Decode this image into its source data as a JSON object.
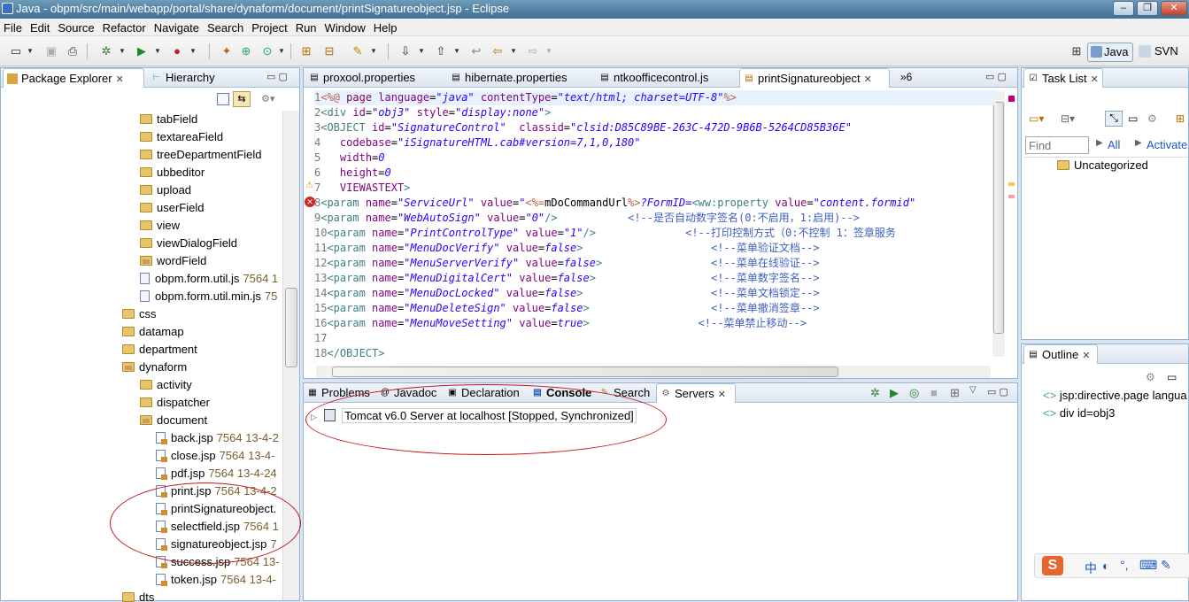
{
  "window": {
    "title": "Java - obpm/src/main/webapp/portal/share/dynaform/document/printSignatureobject.jsp - Eclipse"
  },
  "menu": [
    "File",
    "Edit",
    "Source",
    "Refactor",
    "Navigate",
    "Search",
    "Project",
    "Run",
    "Window",
    "Help"
  ],
  "perspectives": {
    "java": "Java",
    "svn": "SVN"
  },
  "left_tabs": {
    "package_explorer": "Package Explorer",
    "hierarchy": "Hierarchy"
  },
  "tree": [
    {
      "label": "tabField",
      "kind": "folder",
      "indent": 2
    },
    {
      "label": "textareaField",
      "kind": "folder",
      "indent": 2
    },
    {
      "label": "treeDepartmentField",
      "kind": "folder",
      "indent": 2
    },
    {
      "label": "ubbeditor",
      "kind": "folder",
      "indent": 2
    },
    {
      "label": "upload",
      "kind": "folder",
      "indent": 2
    },
    {
      "label": "userField",
      "kind": "folder",
      "indent": 2
    },
    {
      "label": "view",
      "kind": "folder",
      "indent": 2
    },
    {
      "label": "viewDialogField",
      "kind": "folder",
      "indent": 2
    },
    {
      "label": "wordField",
      "kind": "pkgfolder",
      "indent": 2
    },
    {
      "label": "obpm.form.util.js",
      "meta": "7564 1",
      "kind": "js",
      "indent": 2
    },
    {
      "label": "obpm.form.util.min.js",
      "meta": "75",
      "kind": "js",
      "indent": 2
    },
    {
      "label": "css",
      "kind": "folder",
      "indent": 1
    },
    {
      "label": "datamap",
      "kind": "folder",
      "indent": 1
    },
    {
      "label": "department",
      "kind": "folder",
      "indent": 1
    },
    {
      "label": "dynaform",
      "kind": "pkgfolder",
      "indent": 1
    },
    {
      "label": "activity",
      "kind": "folder",
      "indent": 2
    },
    {
      "label": "dispatcher",
      "kind": "folder",
      "indent": 2
    },
    {
      "label": "document",
      "kind": "pkgfolder",
      "indent": 2
    },
    {
      "label": "back.jsp",
      "meta": "7564  13-4-2",
      "kind": "jsp",
      "indent": 3
    },
    {
      "label": "close.jsp",
      "meta": "7564  13-4-",
      "kind": "jsp",
      "indent": 3
    },
    {
      "label": "pdf.jsp",
      "meta": "7564  13-4-24",
      "kind": "jsp",
      "indent": 3
    },
    {
      "label": "print.jsp",
      "meta": "7564  13-4-2",
      "kind": "jsp",
      "indent": 3
    },
    {
      "label": "printSignatureobject.",
      "meta": "",
      "kind": "jsp",
      "indent": 3
    },
    {
      "label": "selectfield.jsp",
      "meta": "7564  1",
      "kind": "jsp",
      "indent": 3
    },
    {
      "label": "signatureobject.jsp",
      "meta": "7",
      "kind": "jsp",
      "indent": 3
    },
    {
      "label": "success.jsp",
      "meta": "7564  13-",
      "kind": "jsp",
      "indent": 3
    },
    {
      "label": "token.jsp",
      "meta": "7564  13-4-",
      "kind": "jsp",
      "indent": 3
    },
    {
      "label": "dts",
      "kind": "folder",
      "indent": 1
    }
  ],
  "editor_tabs": [
    "proxool.properties",
    "hibernate.properties",
    "ntkoofficecontrol.js",
    "printSignatureobject"
  ],
  "editor_overflow": "»6",
  "code_lines": [
    [
      [
        "dir",
        "<%@ "
      ],
      [
        "kw",
        "page "
      ],
      [
        "at",
        "language"
      ],
      [
        "",
        "="
      ],
      [
        "val",
        "\"java\" "
      ],
      [
        "at",
        "contentType"
      ],
      [
        "",
        "="
      ],
      [
        "val",
        "\"text/html; charset=UTF-8\""
      ],
      [
        "dir",
        "%>"
      ]
    ],
    [
      [
        "tag",
        "<div "
      ],
      [
        "at",
        "id"
      ],
      [
        "",
        "="
      ],
      [
        "val",
        "\"obj3\" "
      ],
      [
        "at",
        "style"
      ],
      [
        "",
        "="
      ],
      [
        "val",
        "\"display:none\""
      ],
      [
        "tag",
        ">"
      ]
    ],
    [
      [
        "tag",
        "<OBJECT "
      ],
      [
        "at",
        "id"
      ],
      [
        "",
        "="
      ],
      [
        "val",
        "\"SignatureControl\"  "
      ],
      [
        "at",
        "classid"
      ],
      [
        "",
        "="
      ],
      [
        "val",
        "\"clsid:D85C89BE-263C-472D-9B6B-5264CD85B36E\""
      ]
    ],
    [
      [
        "",
        "   "
      ],
      [
        "at",
        "codebase"
      ],
      [
        "",
        "="
      ],
      [
        "val",
        "\"iSignatureHTML.cab#version=7,1,0,180\""
      ]
    ],
    [
      [
        "",
        "   "
      ],
      [
        "at",
        "width"
      ],
      [
        "",
        "="
      ],
      [
        "val",
        "0"
      ]
    ],
    [
      [
        "",
        "   "
      ],
      [
        "at",
        "height"
      ],
      [
        "",
        "="
      ],
      [
        "val",
        "0"
      ]
    ],
    [
      [
        "",
        "   "
      ],
      [
        "at",
        "VIEWASTEXT"
      ],
      [
        "tag",
        ">"
      ]
    ],
    [
      [
        "tag",
        "<param "
      ],
      [
        "at",
        "name"
      ],
      [
        "",
        "="
      ],
      [
        "val",
        "\"ServiceUrl\" "
      ],
      [
        "at",
        "value"
      ],
      [
        "",
        "="
      ],
      [
        "val",
        "\""
      ],
      [
        "dir",
        "<%="
      ],
      [
        "",
        "mDoCommandUrl"
      ],
      [
        "dir",
        "%>"
      ],
      [
        "val",
        "?FormID="
      ],
      [
        "tag",
        "<ww:property "
      ],
      [
        "at",
        "value"
      ],
      [
        "",
        "="
      ],
      [
        "val",
        "\"content.formid\""
      ]
    ],
    [
      [
        "tag",
        "<param "
      ],
      [
        "at",
        "name"
      ],
      [
        "",
        "="
      ],
      [
        "val",
        "\"WebAutoSign\" "
      ],
      [
        "at",
        "value"
      ],
      [
        "",
        "="
      ],
      [
        "val",
        "\"0\""
      ],
      [
        "tag",
        "/>"
      ],
      [
        "",
        "           "
      ],
      [
        "cm",
        "<!--是否自动数字签名(0:不启用，1:启用)-->"
      ]
    ],
    [
      [
        "tag",
        "<param "
      ],
      [
        "at",
        "name"
      ],
      [
        "",
        "="
      ],
      [
        "val",
        "\"PrintControlType\" "
      ],
      [
        "at",
        "value"
      ],
      [
        "",
        "="
      ],
      [
        "val",
        "\"1\""
      ],
      [
        "tag",
        "/>"
      ],
      [
        "",
        "              "
      ],
      [
        "cm",
        "<!--打印控制方式（0:不控制 1：签章服务"
      ]
    ],
    [
      [
        "tag",
        "<param "
      ],
      [
        "at",
        "name"
      ],
      [
        "",
        "="
      ],
      [
        "val",
        "\"MenuDocVerify\" "
      ],
      [
        "at",
        "value"
      ],
      [
        "",
        "="
      ],
      [
        "val",
        "false"
      ],
      [
        "tag",
        ">"
      ],
      [
        "",
        "                    "
      ],
      [
        "cm",
        "<!--菜单验证文档-->"
      ]
    ],
    [
      [
        "tag",
        "<param "
      ],
      [
        "at",
        "name"
      ],
      [
        "",
        "="
      ],
      [
        "val",
        "\"MenuServerVerify\" "
      ],
      [
        "at",
        "value"
      ],
      [
        "",
        "="
      ],
      [
        "val",
        "false"
      ],
      [
        "tag",
        ">"
      ],
      [
        "",
        "                 "
      ],
      [
        "cm",
        "<!--菜单在线验证-->"
      ]
    ],
    [
      [
        "tag",
        "<param "
      ],
      [
        "at",
        "name"
      ],
      [
        "",
        "="
      ],
      [
        "val",
        "\"MenuDigitalCert\" "
      ],
      [
        "at",
        "value"
      ],
      [
        "",
        "="
      ],
      [
        "val",
        "false"
      ],
      [
        "tag",
        ">"
      ],
      [
        "",
        "                  "
      ],
      [
        "cm",
        "<!--菜单数字签名-->"
      ]
    ],
    [
      [
        "tag",
        "<param "
      ],
      [
        "at",
        "name"
      ],
      [
        "",
        "="
      ],
      [
        "val",
        "\"MenuDocLocked\" "
      ],
      [
        "at",
        "value"
      ],
      [
        "",
        "="
      ],
      [
        "val",
        "false"
      ],
      [
        "tag",
        ">"
      ],
      [
        "",
        "                    "
      ],
      [
        "cm",
        "<!--菜单文档锁定-->"
      ]
    ],
    [
      [
        "tag",
        "<param "
      ],
      [
        "at",
        "name"
      ],
      [
        "",
        "="
      ],
      [
        "val",
        "\"MenuDeleteSign\" "
      ],
      [
        "at",
        "value"
      ],
      [
        "",
        "="
      ],
      [
        "val",
        "false"
      ],
      [
        "tag",
        ">"
      ],
      [
        "",
        "                   "
      ],
      [
        "cm",
        "<!--菜单撤消签章-->"
      ]
    ],
    [
      [
        "tag",
        "<param "
      ],
      [
        "at",
        "name"
      ],
      [
        "",
        "="
      ],
      [
        "val",
        "\"MenuMoveSetting\" "
      ],
      [
        "at",
        "value"
      ],
      [
        "",
        "="
      ],
      [
        "val",
        "true"
      ],
      [
        "tag",
        ">"
      ],
      [
        "",
        "                 "
      ],
      [
        "cm",
        "<!--菜单禁止移动-->"
      ]
    ],
    [
      [
        "",
        ""
      ]
    ],
    [
      [
        "tag",
        "</OBJECT>"
      ]
    ]
  ],
  "bottom_tabs": [
    "Problems",
    "Javadoc",
    "Declaration",
    "Console",
    "Search",
    "Servers"
  ],
  "server_entry": "Tomcat v6.0 Server at localhost  [Stopped, Synchronized]",
  "tasklist": {
    "tab": "Task List",
    "find_placeholder": "Find",
    "all": "All",
    "activate": "Activate...",
    "uncategorized": "Uncategorized"
  },
  "outline": {
    "tab": "Outline",
    "items": [
      "jsp:directive.page langua",
      "div id=obj3"
    ]
  },
  "ime": {
    "lang": "中"
  }
}
